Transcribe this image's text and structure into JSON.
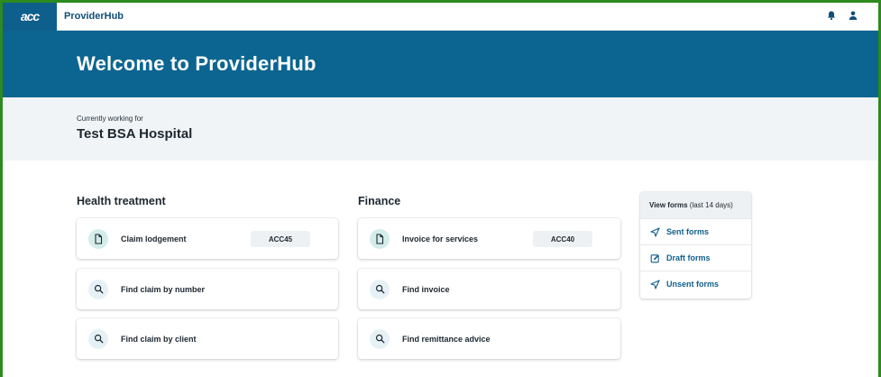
{
  "header": {
    "logo_text": "acc",
    "app_name": "ProviderHub"
  },
  "banner": {
    "title": "Welcome to ProviderHub"
  },
  "context": {
    "label": "Currently working for",
    "organisation": "Test BSA Hospital"
  },
  "health": {
    "title": "Health treatment",
    "items": [
      {
        "label": "Claim lodgement",
        "badge": "ACC45",
        "icon": "document-icon"
      },
      {
        "label": "Find claim by number",
        "icon": "search-icon"
      },
      {
        "label": "Find claim by client",
        "icon": "search-icon"
      }
    ]
  },
  "finance": {
    "title": "Finance",
    "items": [
      {
        "label": "Invoice for services",
        "badge": "ACC40",
        "icon": "document-icon"
      },
      {
        "label": "Find invoice",
        "icon": "search-icon"
      },
      {
        "label": "Find remittance advice",
        "icon": "search-icon"
      }
    ]
  },
  "forms": {
    "title": "View forms",
    "subtitle": "(last 14 days)",
    "items": [
      {
        "label": "Sent forms",
        "icon": "send-icon"
      },
      {
        "label": "Draft forms",
        "icon": "edit-icon"
      },
      {
        "label": "Unsent forms",
        "icon": "send-icon"
      }
    ]
  },
  "colors": {
    "brand": "#0b6590",
    "link": "#0f5f8c",
    "frame": "#2c8a1e"
  }
}
